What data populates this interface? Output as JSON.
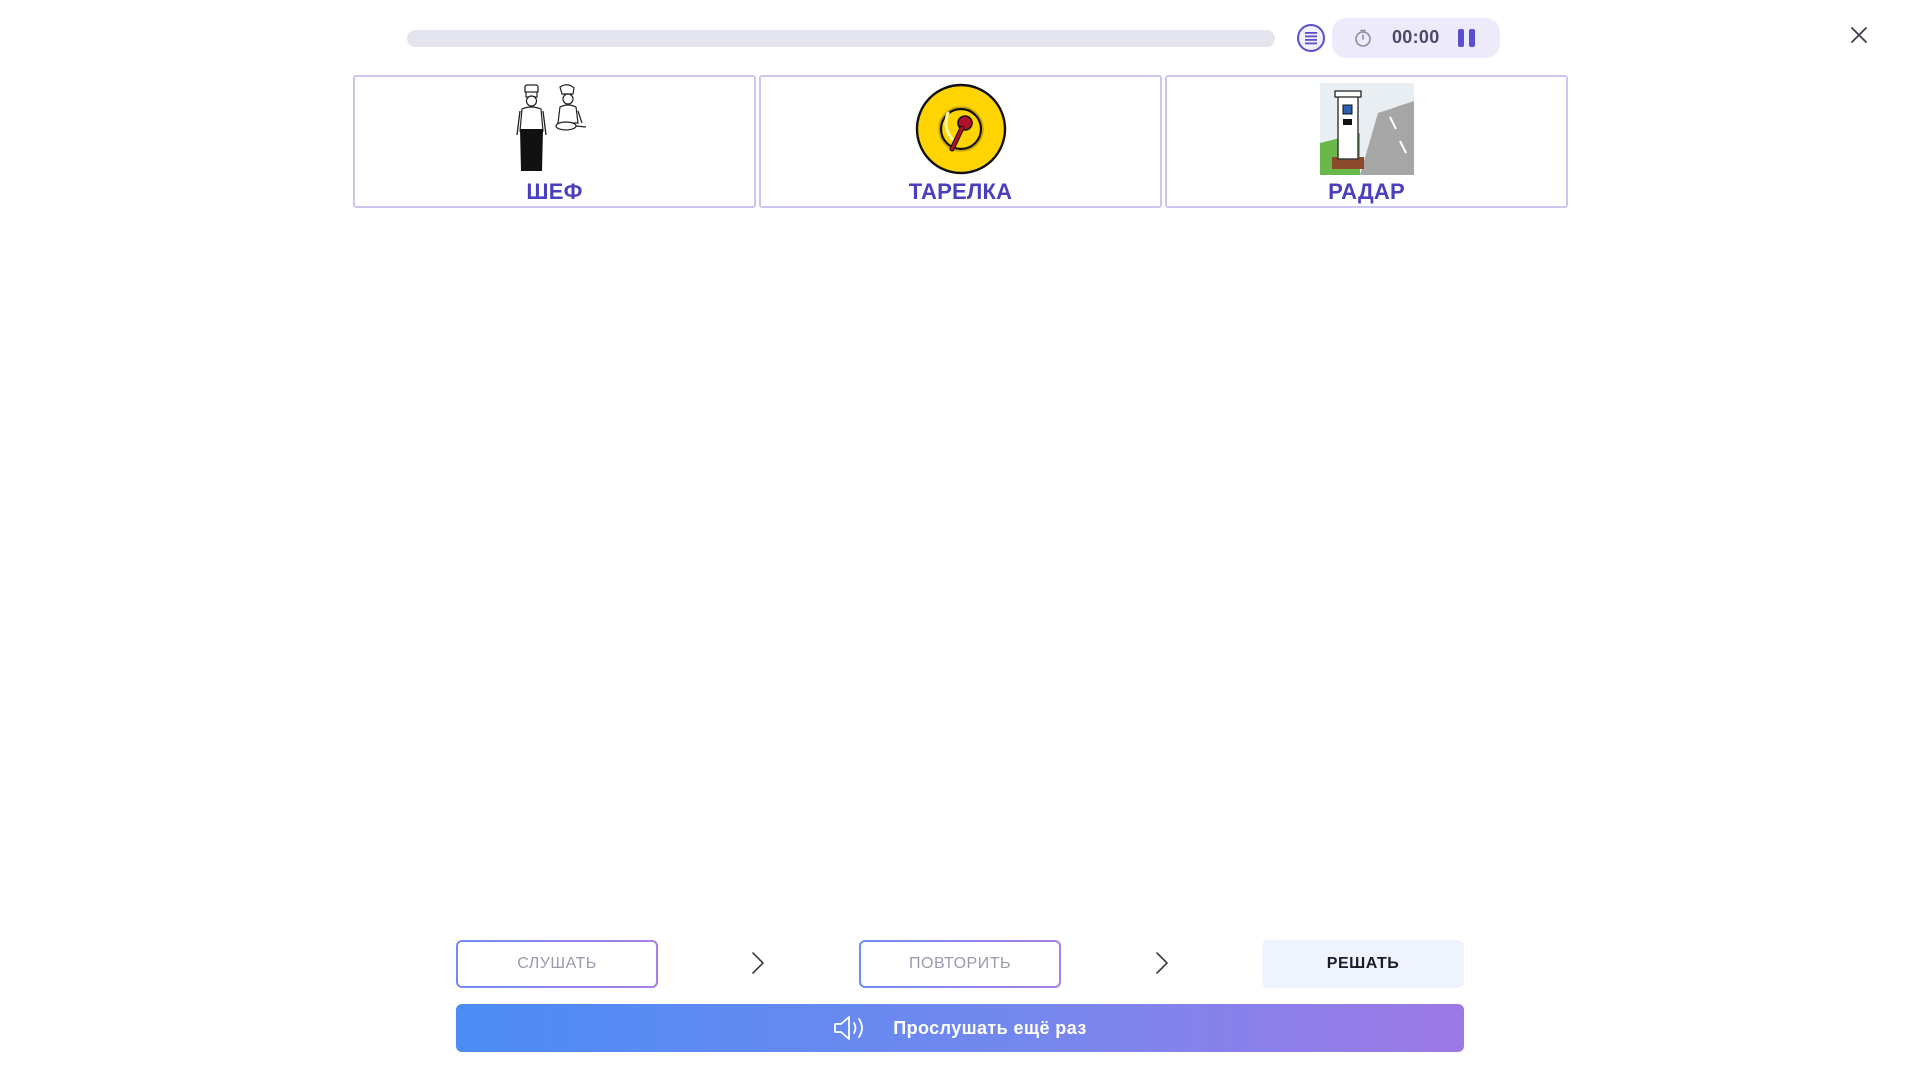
{
  "topbar": {
    "progress_percent": 0,
    "timer": "00:00",
    "icons": {
      "menu": "list-menu-icon",
      "timer": "stopwatch-icon",
      "pause": "pause-icon",
      "close": "close-icon"
    }
  },
  "cards": [
    {
      "label": "ШЕФ",
      "image": "chef-picture"
    },
    {
      "label": "ТАРЕЛКА",
      "image": "plate-picture"
    },
    {
      "label": "РАДАР",
      "image": "radar-picture"
    }
  ],
  "steps": {
    "listen": "СЛУШАТЬ",
    "repeat": "ПОВТОРИТЬ",
    "solve": "РЕШАТЬ"
  },
  "replay": {
    "label": "Прослушать ещё раз",
    "icon": "speaker-icon"
  },
  "colors": {
    "accent": "#4a3fbf",
    "card_border": "#c9c7ee",
    "replay_gradient_start": "#4b8cf5",
    "replay_gradient_end": "#9d79e6"
  }
}
